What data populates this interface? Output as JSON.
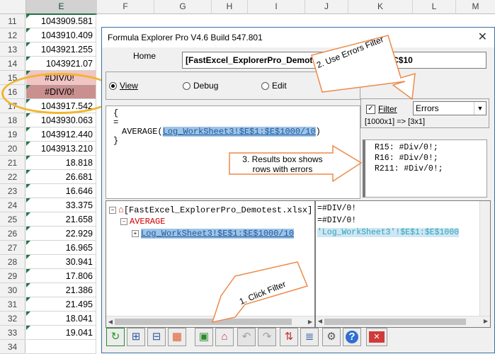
{
  "sheet": {
    "columns": [
      "E",
      "F",
      "G",
      "H",
      "I",
      "J",
      "K",
      "L",
      "M"
    ],
    "rows": [
      {
        "num": "11",
        "value": "1043909.581",
        "kind": "normal"
      },
      {
        "num": "12",
        "value": "1043910.409",
        "kind": "normal"
      },
      {
        "num": "13",
        "value": "1043921.255",
        "kind": "normal"
      },
      {
        "num": "14",
        "value": "1043921.07",
        "kind": "normal"
      },
      {
        "num": "15",
        "value": "#DIV/0!",
        "kind": "err1"
      },
      {
        "num": "16",
        "value": "#DIV/0!",
        "kind": "err2"
      },
      {
        "num": "17",
        "value": "1043917.542",
        "kind": "normal"
      },
      {
        "num": "18",
        "value": "1043930.063",
        "kind": "normal"
      },
      {
        "num": "19",
        "value": "1043912.440",
        "kind": "normal"
      },
      {
        "num": "20",
        "value": "1043913.210",
        "kind": "normal"
      },
      {
        "num": "21",
        "value": "18.818",
        "kind": "normal"
      },
      {
        "num": "22",
        "value": "26.681",
        "kind": "normal"
      },
      {
        "num": "23",
        "value": "16.646",
        "kind": "normal"
      },
      {
        "num": "24",
        "value": "33.375",
        "kind": "normal"
      },
      {
        "num": "25",
        "value": "21.658",
        "kind": "normal"
      },
      {
        "num": "26",
        "value": "22.929",
        "kind": "normal"
      },
      {
        "num": "27",
        "value": "16.965",
        "kind": "normal"
      },
      {
        "num": "28",
        "value": "30.941",
        "kind": "normal"
      },
      {
        "num": "29",
        "value": "17.806",
        "kind": "normal"
      },
      {
        "num": "30",
        "value": "21.386",
        "kind": "normal"
      },
      {
        "num": "31",
        "value": "21.495",
        "kind": "normal"
      },
      {
        "num": "32",
        "value": "18.041",
        "kind": "normal"
      },
      {
        "num": "33",
        "value": "19.041",
        "kind": "normal"
      },
      {
        "num": "34",
        "value": "",
        "kind": "normal"
      }
    ]
  },
  "dialog": {
    "title": "Formula Explorer Pro V4.6 Build 547.801",
    "close_glyph": "✕",
    "home_label": "Home",
    "home_value": "[FastExcel_ExplorerPro_Demotest.xlsx]Formulas!$C$10",
    "modes": {
      "view": "View",
      "debug": "Debug",
      "edit": "Edit",
      "selected": "view"
    },
    "formula": {
      "line1": "{",
      "line2": "=",
      "line3_prefix": "AVERAGE(",
      "line3_ref": "Log_WorkSheet3!$E$1:$E$1000/10",
      "line3_suffix": ")",
      "line4": "}"
    },
    "filter": {
      "label": "Filter",
      "checked": true,
      "selected": "Errors",
      "dims": "[1000x1] => [3x1]"
    },
    "results": [
      "R15: #Div/0!;",
      "R16: #Div/0!;",
      "R211: #Div/0!;"
    ],
    "tree": {
      "root": "[FastExcel_ExplorerPro_Demotest.xlsx]",
      "fn": "AVERAGE",
      "arg": "Log_WorkSheet3!$E$1:$E$1000/10"
    },
    "eval": [
      "=#DIV/0!",
      "=#DIV/0!",
      "'Log_WorkSheet3'!$E$1:$E$1000"
    ]
  },
  "callouts": {
    "c1": "1. Click Filter",
    "c2": "2. Use Errors Filter",
    "c3": "3. Results box shows rows with errors"
  },
  "colors": {
    "accent": "#217346",
    "callout_fill": "#ffffff",
    "callout_border": "#ee8a4a",
    "error_light": "#f2c4c4",
    "error_dark": "#c9908f",
    "highlight": "#9dc3e6"
  }
}
